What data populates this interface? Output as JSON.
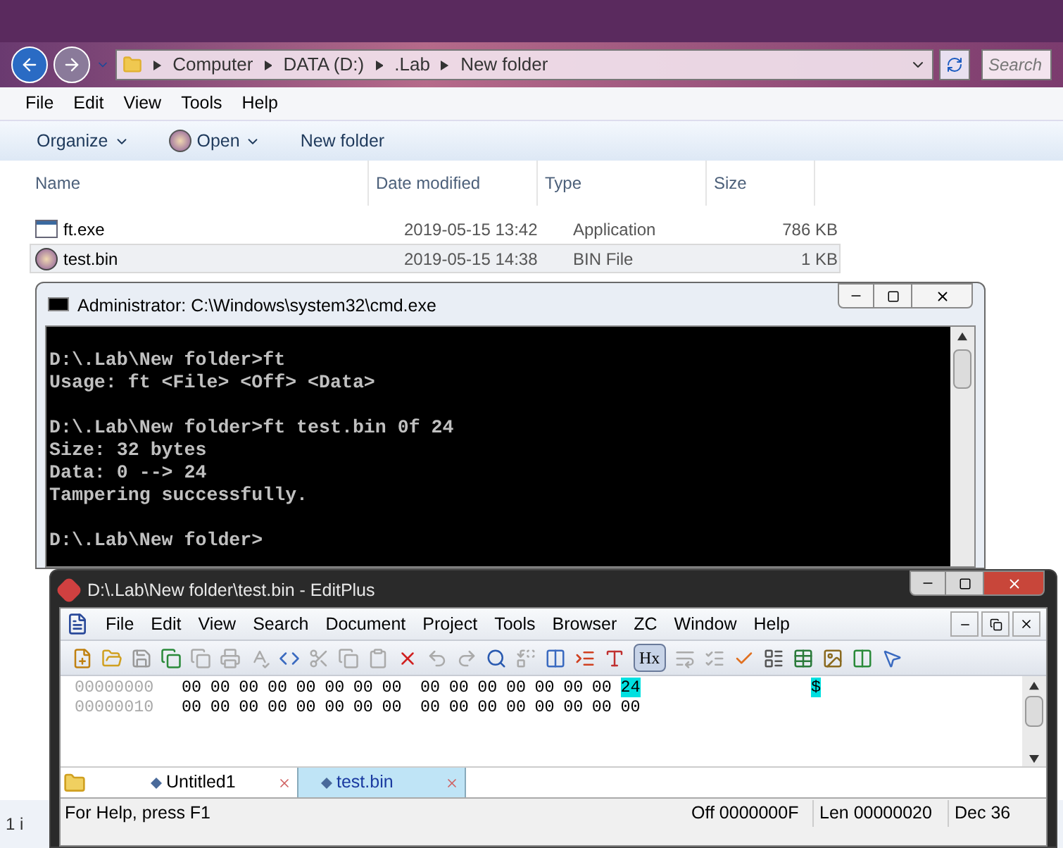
{
  "explorer": {
    "breadcrumb": [
      "Computer",
      "DATA (D:)",
      ".Lab",
      "New folder"
    ],
    "search": {
      "placeholder": "Search"
    },
    "menu": [
      "File",
      "Edit",
      "View",
      "Tools",
      "Help"
    ],
    "toolbar": [
      {
        "label": "Organize",
        "kind": "menu"
      },
      {
        "label": "Open",
        "kind": "open"
      },
      {
        "label": "New folder",
        "kind": "plain"
      }
    ],
    "columns": [
      "Name",
      "Date modified",
      "Type",
      "Size"
    ],
    "rows": [
      {
        "name": "ft.exe",
        "kind": "app",
        "date": "2019-05-15 13:42",
        "type": "Application",
        "size": "786 KB",
        "selected": false
      },
      {
        "name": "test.bin",
        "kind": "bin",
        "date": "2019-05-15 14:38",
        "type": "BIN File",
        "size": "1 KB",
        "selected": true
      }
    ],
    "status_bar": "1 i"
  },
  "cmd": {
    "title": "Administrator: C:\\Windows\\system32\\cmd.exe",
    "blocks": [
      [
        "D:\\.Lab\\New folder>ft",
        "Usage: ft <File> <Off> <Data>"
      ],
      [
        "D:\\.Lab\\New folder>ft test.bin 0f 24",
        "Size: 32 bytes",
        "Data: 0 --> 24",
        "Tampering successfully."
      ],
      [
        "D:\\.Lab\\New folder>"
      ]
    ]
  },
  "editplus": {
    "title": "D:\\.Lab\\New folder\\test.bin - EditPlus",
    "menu": [
      "File",
      "Edit",
      "View",
      "Search",
      "Document",
      "Project",
      "Tools",
      "Browser",
      "ZC",
      "Window",
      "Help"
    ],
    "hex_toggle": {
      "label": "Hx",
      "selected": true
    },
    "rows": [
      {
        "address": "00000000",
        "bytes": [
          {
            "value": "00",
            "selected": false
          },
          {
            "value": "00",
            "selected": false
          },
          {
            "value": "00",
            "selected": false
          },
          {
            "value": "00",
            "selected": false
          },
          {
            "value": "00",
            "selected": false
          },
          {
            "value": "00",
            "selected": false
          },
          {
            "value": "00",
            "selected": false
          },
          {
            "value": "00",
            "selected": false
          },
          {
            "value": "00",
            "selected": false
          },
          {
            "value": "00",
            "selected": false
          },
          {
            "value": "00",
            "selected": false
          },
          {
            "value": "00",
            "selected": false
          },
          {
            "value": "00",
            "selected": false
          },
          {
            "value": "00",
            "selected": false
          },
          {
            "value": "00",
            "selected": false
          },
          {
            "value": "24",
            "char": "$",
            "selected": true
          }
        ]
      },
      {
        "address": "00000010",
        "bytes": [
          {
            "value": "00",
            "selected": false
          },
          {
            "value": "00",
            "selected": false
          },
          {
            "value": "00",
            "selected": false
          },
          {
            "value": "00",
            "selected": false
          },
          {
            "value": "00",
            "selected": false
          },
          {
            "value": "00",
            "selected": false
          },
          {
            "value": "00",
            "selected": false
          },
          {
            "value": "00",
            "selected": false
          },
          {
            "value": "00",
            "selected": false
          },
          {
            "value": "00",
            "selected": false
          },
          {
            "value": "00",
            "selected": false
          },
          {
            "value": "00",
            "selected": false
          },
          {
            "value": "00",
            "selected": false
          },
          {
            "value": "00",
            "selected": false
          },
          {
            "value": "00",
            "selected": false
          },
          {
            "value": "00",
            "selected": false
          }
        ]
      }
    ],
    "tabs": [
      {
        "label": "Untitled1",
        "selected": false
      },
      {
        "label": "test.bin",
        "selected": true
      }
    ],
    "status_bar": [
      "For Help, press F1",
      "Off 0000000F",
      "Len 00000020",
      "Dec 36"
    ]
  }
}
